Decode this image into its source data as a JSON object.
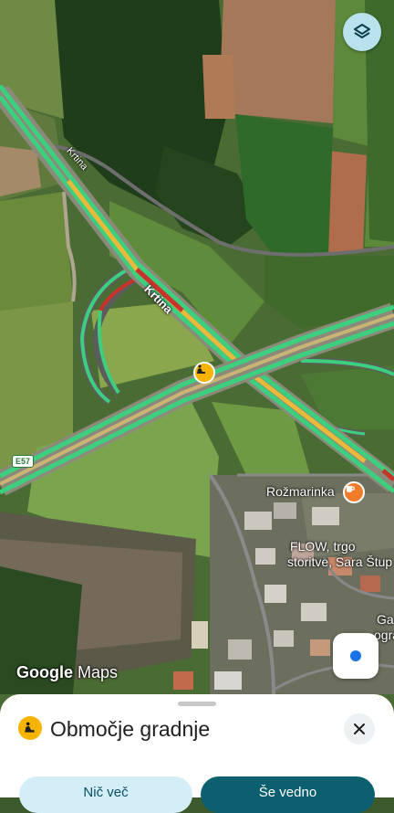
{
  "map": {
    "road_labels": {
      "krtina_top": "Krtina",
      "krtina_mid": "Krtina",
      "e57": "E57"
    },
    "places": {
      "rozmarinka": "Rožmarinka",
      "flow_line1": "FLOW, trgo",
      "flow_line2": "storitve, Sara Štup",
      "partial1": "Ga",
      "partial2": "ogra"
    },
    "construction_marker": "construction-icon",
    "cafe_marker": "coffee-cup-icon",
    "attribution": {
      "google": "Google",
      "maps": "Maps"
    }
  },
  "controls": {
    "layers_icon": "layers-icon",
    "my_location_icon": "my-location-icon"
  },
  "sheet": {
    "title": "Območje gradnje",
    "title_icon": "construction-icon",
    "close_icon": "close-icon",
    "button_less": "Nič več",
    "button_still": "Še vedno"
  },
  "colors": {
    "traffic_green": "#3ccf7e",
    "traffic_yellow": "#e9b93c",
    "traffic_red": "#c8342b",
    "construction": "#f6b300",
    "location_blue": "#1a73e8",
    "button_dark": "#0b5f6f",
    "button_light": "#d3eef7"
  }
}
